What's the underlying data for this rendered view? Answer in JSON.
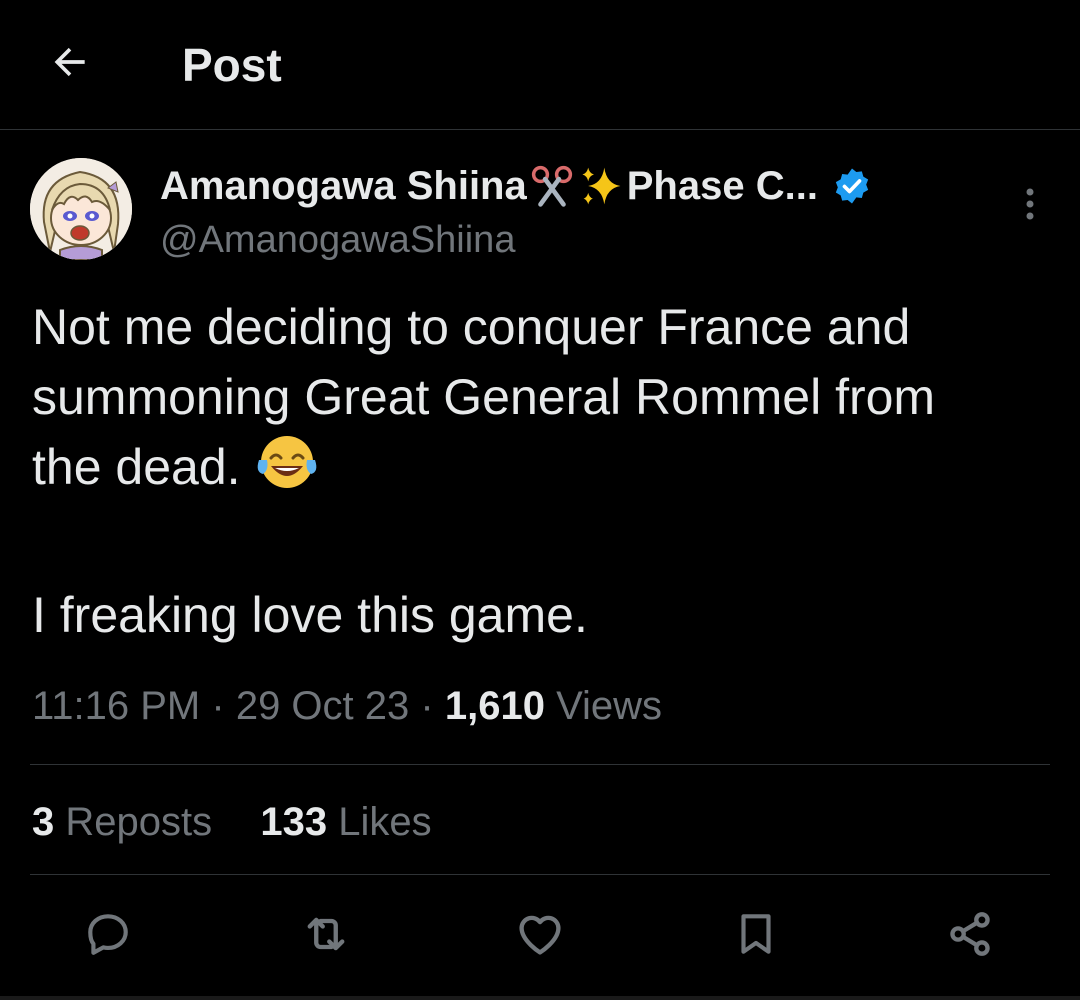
{
  "header": {
    "title": "Post",
    "back_icon": "arrow-left-icon"
  },
  "author": {
    "display_name": "Amanogawa Shiina",
    "display_name_suffix": "Phase C...",
    "name_emojis": [
      "scissors-emoji",
      "sparkles-emoji"
    ],
    "handle": "@AmanogawaShiina",
    "verified": true,
    "verified_color": "#1d9bf0",
    "avatar": "anime-avatar"
  },
  "post": {
    "lines": [
      "Not me deciding to conquer France and",
      "summoning Great General Rommel from",
      "the dead."
    ],
    "inline_emoji": "face-with-tears-of-joy-emoji",
    "second_paragraph": "I freaking love this game."
  },
  "meta": {
    "time": "11:16 PM",
    "sep1": "·",
    "date": "29 Oct 23",
    "sep2": "·",
    "views_count": "1,610",
    "views_label": "Views"
  },
  "stats": {
    "reposts_count": "3",
    "reposts_label": "Reposts",
    "likes_count": "133",
    "likes_label": "Likes"
  },
  "actions": [
    "reply-icon",
    "repost-icon",
    "like-icon",
    "bookmark-icon",
    "share-icon"
  ],
  "colors": {
    "background": "#000000",
    "text": "#e7e9ea",
    "secondary": "#71767b",
    "divider": "#2f3336",
    "accent": "#1d9bf0"
  }
}
